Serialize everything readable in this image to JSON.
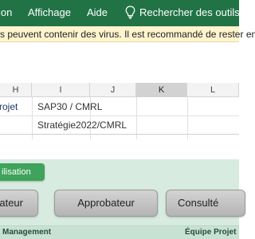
{
  "ribbon": {
    "menu_insert": "ion",
    "menu_view": "Affichage",
    "menu_help": "Aide",
    "search_placeholder": "Rechercher des outils a"
  },
  "warning": {
    "text": "s peuvent contenir des virus. Il est recommandé de rester en"
  },
  "sheet": {
    "columns": [
      "H",
      "I",
      "J",
      "K",
      "L"
    ],
    "selected_column": "K",
    "rows": [
      {
        "h": "rojet",
        "i": "SAP30 / CMRL"
      },
      {
        "h": "",
        "i": "Stratégie2022/CMRL"
      }
    ]
  },
  "form": {
    "tab_label": "ilisation",
    "buttons": [
      "ateur",
      "Approbateur",
      "Consulté"
    ],
    "footer": [
      "Management",
      "Équipe Projet"
    ]
  },
  "colors": {
    "ribbon": "#217346",
    "warning": "#fff4ce",
    "form_bg": "#d8ebe0",
    "tab": "#3fa35b"
  }
}
